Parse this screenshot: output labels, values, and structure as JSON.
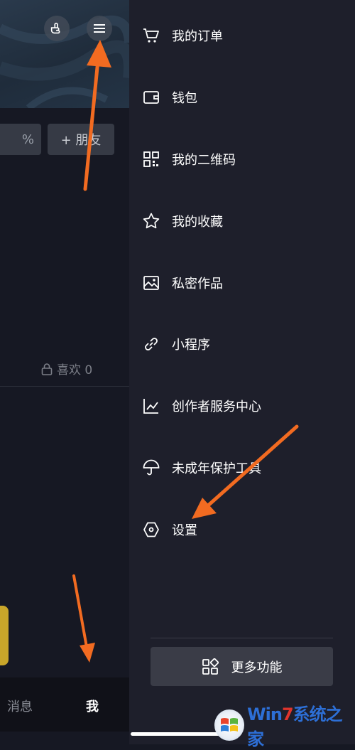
{
  "profile": {
    "percent_button": "%",
    "add_friend_label": "+ 朋友",
    "likes_label": "喜欢 0"
  },
  "bottom_tabs": {
    "messages": "消息",
    "me": "我"
  },
  "drawer": {
    "items": [
      {
        "label": "我的订单",
        "icon": "cart-icon"
      },
      {
        "label": "钱包",
        "icon": "wallet-icon"
      },
      {
        "label": "我的二维码",
        "icon": "qr-code-icon"
      },
      {
        "label": "我的收藏",
        "icon": "star-icon"
      },
      {
        "label": "私密作品",
        "icon": "private-image-icon"
      },
      {
        "label": "小程序",
        "icon": "link-icon"
      },
      {
        "label": "创作者服务中心",
        "icon": "chart-icon"
      },
      {
        "label": "未成年保护工具",
        "icon": "umbrella-icon"
      },
      {
        "label": "设置",
        "icon": "settings-hexagon-icon"
      }
    ],
    "more_label": "更多功能"
  },
  "watermark": {
    "prefix": "Win",
    "seven": "7",
    "suffix": "系统之家"
  },
  "colors": {
    "background": "#161823",
    "drawer": "#1e1f2b",
    "arrow": "#f26b21",
    "button": "#3a3c47"
  }
}
